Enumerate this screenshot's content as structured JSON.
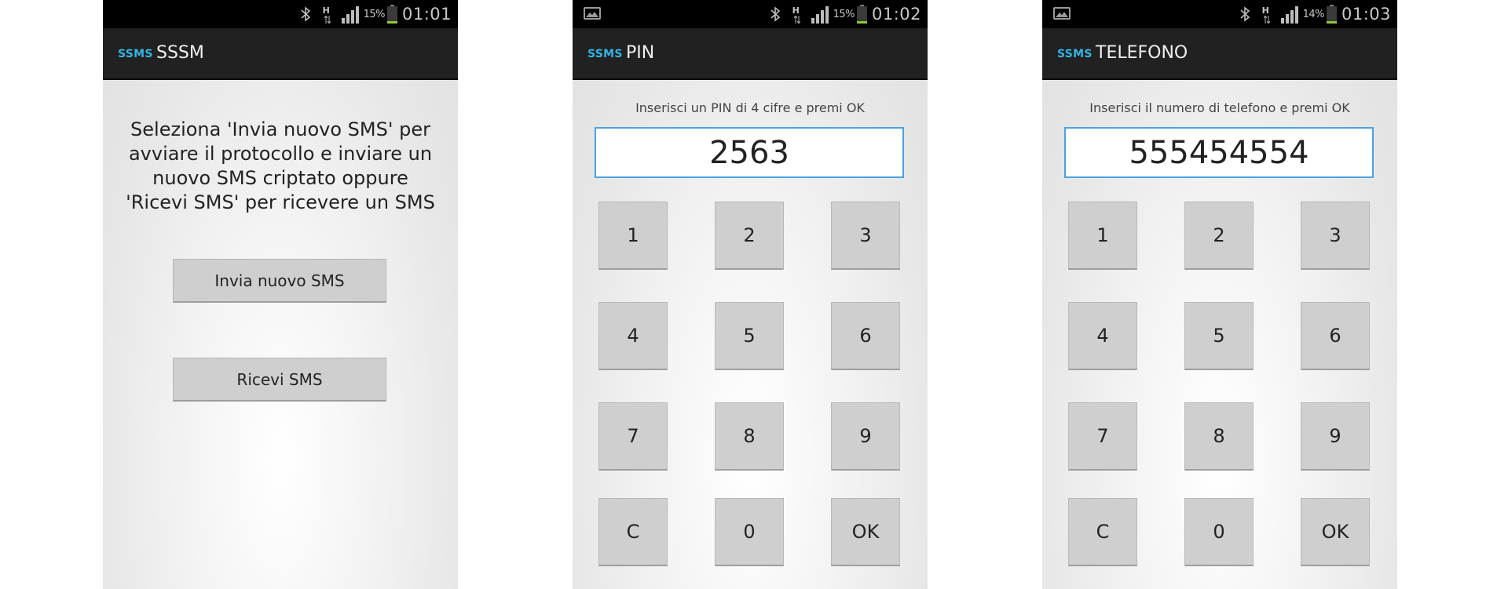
{
  "screens": [
    {
      "status": {
        "battery": "15%",
        "time": "01:01",
        "battery_level": 0.15
      },
      "app_logo": "SSMS",
      "title": "SSSM",
      "message": "Seleziona 'Invia nuovo SMS' per avviare il protocollo e inviare un nuovo SMS criptato oppure 'Ricevi SMS' per ricevere un SMS",
      "buttons": {
        "send": "Invia nuovo SMS",
        "receive": "Ricevi SMS"
      }
    },
    {
      "status": {
        "battery": "15%",
        "time": "01:02",
        "battery_level": 0.15
      },
      "app_logo": "SSMS",
      "title": "PIN",
      "instruction": "Inserisci un PIN di 4 cifre e premi OK",
      "display": "2563"
    },
    {
      "status": {
        "battery": "14%",
        "time": "01:03",
        "battery_level": 0.14
      },
      "app_logo": "SSMS",
      "title": "TELEFONO",
      "instruction": "Inserisci il numero di telefono e premi OK",
      "display": "555454554"
    }
  ],
  "keypad": [
    "1",
    "2",
    "3",
    "4",
    "5",
    "6",
    "7",
    "8",
    "9",
    "C",
    "0",
    "OK"
  ],
  "colors": {
    "accent": "#33b5e5",
    "field_border": "#4aa3df",
    "battery_fill": "#8ec63f",
    "action_bar": "#212121"
  }
}
